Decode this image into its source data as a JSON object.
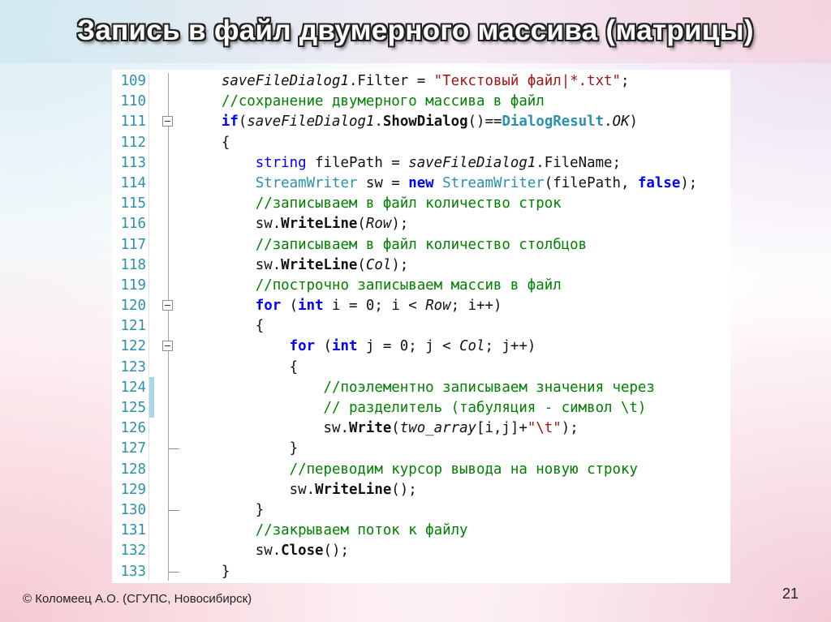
{
  "slide": {
    "title": "Запись в файл двумерного массива (матрицы)",
    "footer": "© Коломеец А.О. (СГУПС, Новосибирск)",
    "page_number": "21"
  },
  "code": {
    "line_numbers": [
      "109",
      "110",
      "111",
      "112",
      "113",
      "114",
      "115",
      "116",
      "117",
      "118",
      "119",
      "120",
      "121",
      "122",
      "123",
      "124",
      "125",
      "126",
      "127",
      "128",
      "129",
      "130",
      "131",
      "132",
      "133"
    ],
    "lines": [
      {
        "t": [
          [
            "    "
          ],
          [
            "saveFileDialog1",
            "it"
          ],
          [
            ".Filter = "
          ],
          [
            "\"Текстовый файл|*.txt\"",
            "str"
          ],
          [
            ";"
          ]
        ]
      },
      {
        "t": [
          [
            "    "
          ],
          [
            "//сохранение двумерного массива в файл",
            "cm"
          ]
        ]
      },
      {
        "t": [
          [
            "    "
          ],
          [
            "if",
            "kw b"
          ],
          [
            "("
          ],
          [
            "saveFileDialog1",
            "it"
          ],
          [
            "."
          ],
          [
            "ShowDialog",
            "b"
          ],
          [
            "()=="
          ],
          [
            "DialogResult",
            "ty b"
          ],
          [
            "."
          ],
          [
            "OK",
            "it"
          ],
          [
            ")"
          ]
        ]
      },
      {
        "t": [
          [
            "    {"
          ]
        ]
      },
      {
        "t": [
          [
            "        "
          ],
          [
            "string",
            "kw"
          ],
          [
            " filePath = "
          ],
          [
            "saveFileDialog1",
            "it"
          ],
          [
            ".FileName;"
          ]
        ]
      },
      {
        "t": [
          [
            "        "
          ],
          [
            "StreamWriter",
            "ty"
          ],
          [
            " sw = "
          ],
          [
            "new",
            "kw b"
          ],
          [
            " "
          ],
          [
            "StreamWriter",
            "ty"
          ],
          [
            "(filePath, "
          ],
          [
            "false",
            "kw b"
          ],
          [
            ");"
          ]
        ]
      },
      {
        "t": [
          [
            "        "
          ],
          [
            "//записываем в файл количество строк",
            "cm"
          ]
        ]
      },
      {
        "t": [
          [
            "        sw."
          ],
          [
            "WriteLine",
            "b"
          ],
          [
            "("
          ],
          [
            "Row",
            "it"
          ],
          [
            ");"
          ]
        ]
      },
      {
        "t": [
          [
            "        "
          ],
          [
            "//записываем в файл количество столбцов",
            "cm"
          ]
        ]
      },
      {
        "t": [
          [
            "        sw."
          ],
          [
            "WriteLine",
            "b"
          ],
          [
            "("
          ],
          [
            "Col",
            "it"
          ],
          [
            ");"
          ]
        ]
      },
      {
        "t": [
          [
            "        "
          ],
          [
            "//построчно записываем массив в файл",
            "cm"
          ]
        ]
      },
      {
        "t": [
          [
            "        "
          ],
          [
            "for",
            "kw b"
          ],
          [
            " ("
          ],
          [
            "int",
            "kw b"
          ],
          [
            " i = 0; i < "
          ],
          [
            "Row",
            "it"
          ],
          [
            "; i++)"
          ]
        ]
      },
      {
        "t": [
          [
            "        {"
          ]
        ]
      },
      {
        "t": [
          [
            "            "
          ],
          [
            "for",
            "kw b"
          ],
          [
            " ("
          ],
          [
            "int",
            "kw b"
          ],
          [
            " j = 0; j < "
          ],
          [
            "Col",
            "it"
          ],
          [
            "; j++)"
          ]
        ]
      },
      {
        "t": [
          [
            "            {"
          ]
        ]
      },
      {
        "t": [
          [
            "                "
          ],
          [
            "//поэлементно записываем значения через",
            "cm"
          ]
        ]
      },
      {
        "t": [
          [
            "                "
          ],
          [
            "// разделитель (табуляция - символ \\t)",
            "cm"
          ]
        ]
      },
      {
        "t": [
          [
            "                sw."
          ],
          [
            "Write",
            "b"
          ],
          [
            "("
          ],
          [
            "two_array",
            "it"
          ],
          [
            "[i,j]+"
          ],
          [
            "\"\\t\"",
            "str"
          ],
          [
            ");"
          ]
        ]
      },
      {
        "t": [
          [
            "            }"
          ]
        ]
      },
      {
        "t": [
          [
            "            "
          ],
          [
            "//переводим курсор вывода на новую строку",
            "cm"
          ]
        ]
      },
      {
        "t": [
          [
            "            sw."
          ],
          [
            "WriteLine",
            "b"
          ],
          [
            "();"
          ]
        ]
      },
      {
        "t": [
          [
            "        }"
          ]
        ]
      },
      {
        "t": [
          [
            "        "
          ],
          [
            "//закрываем поток к файлу",
            "cm"
          ]
        ]
      },
      {
        "t": [
          [
            "        sw."
          ],
          [
            "Close",
            "b"
          ],
          [
            "();"
          ]
        ]
      },
      {
        "t": [
          [
            "    }"
          ]
        ]
      }
    ],
    "fold_open_lines": [
      2,
      11,
      13
    ],
    "fold_end_lines": [
      18,
      21,
      24
    ],
    "changed_lines": [
      15,
      16
    ],
    "colors": {
      "keyword": "#0000ff",
      "type": "#2b91af",
      "string": "#a31515",
      "comment": "#008000",
      "line_number": "#2b91af",
      "change_marker": "#a8d7e6"
    }
  }
}
